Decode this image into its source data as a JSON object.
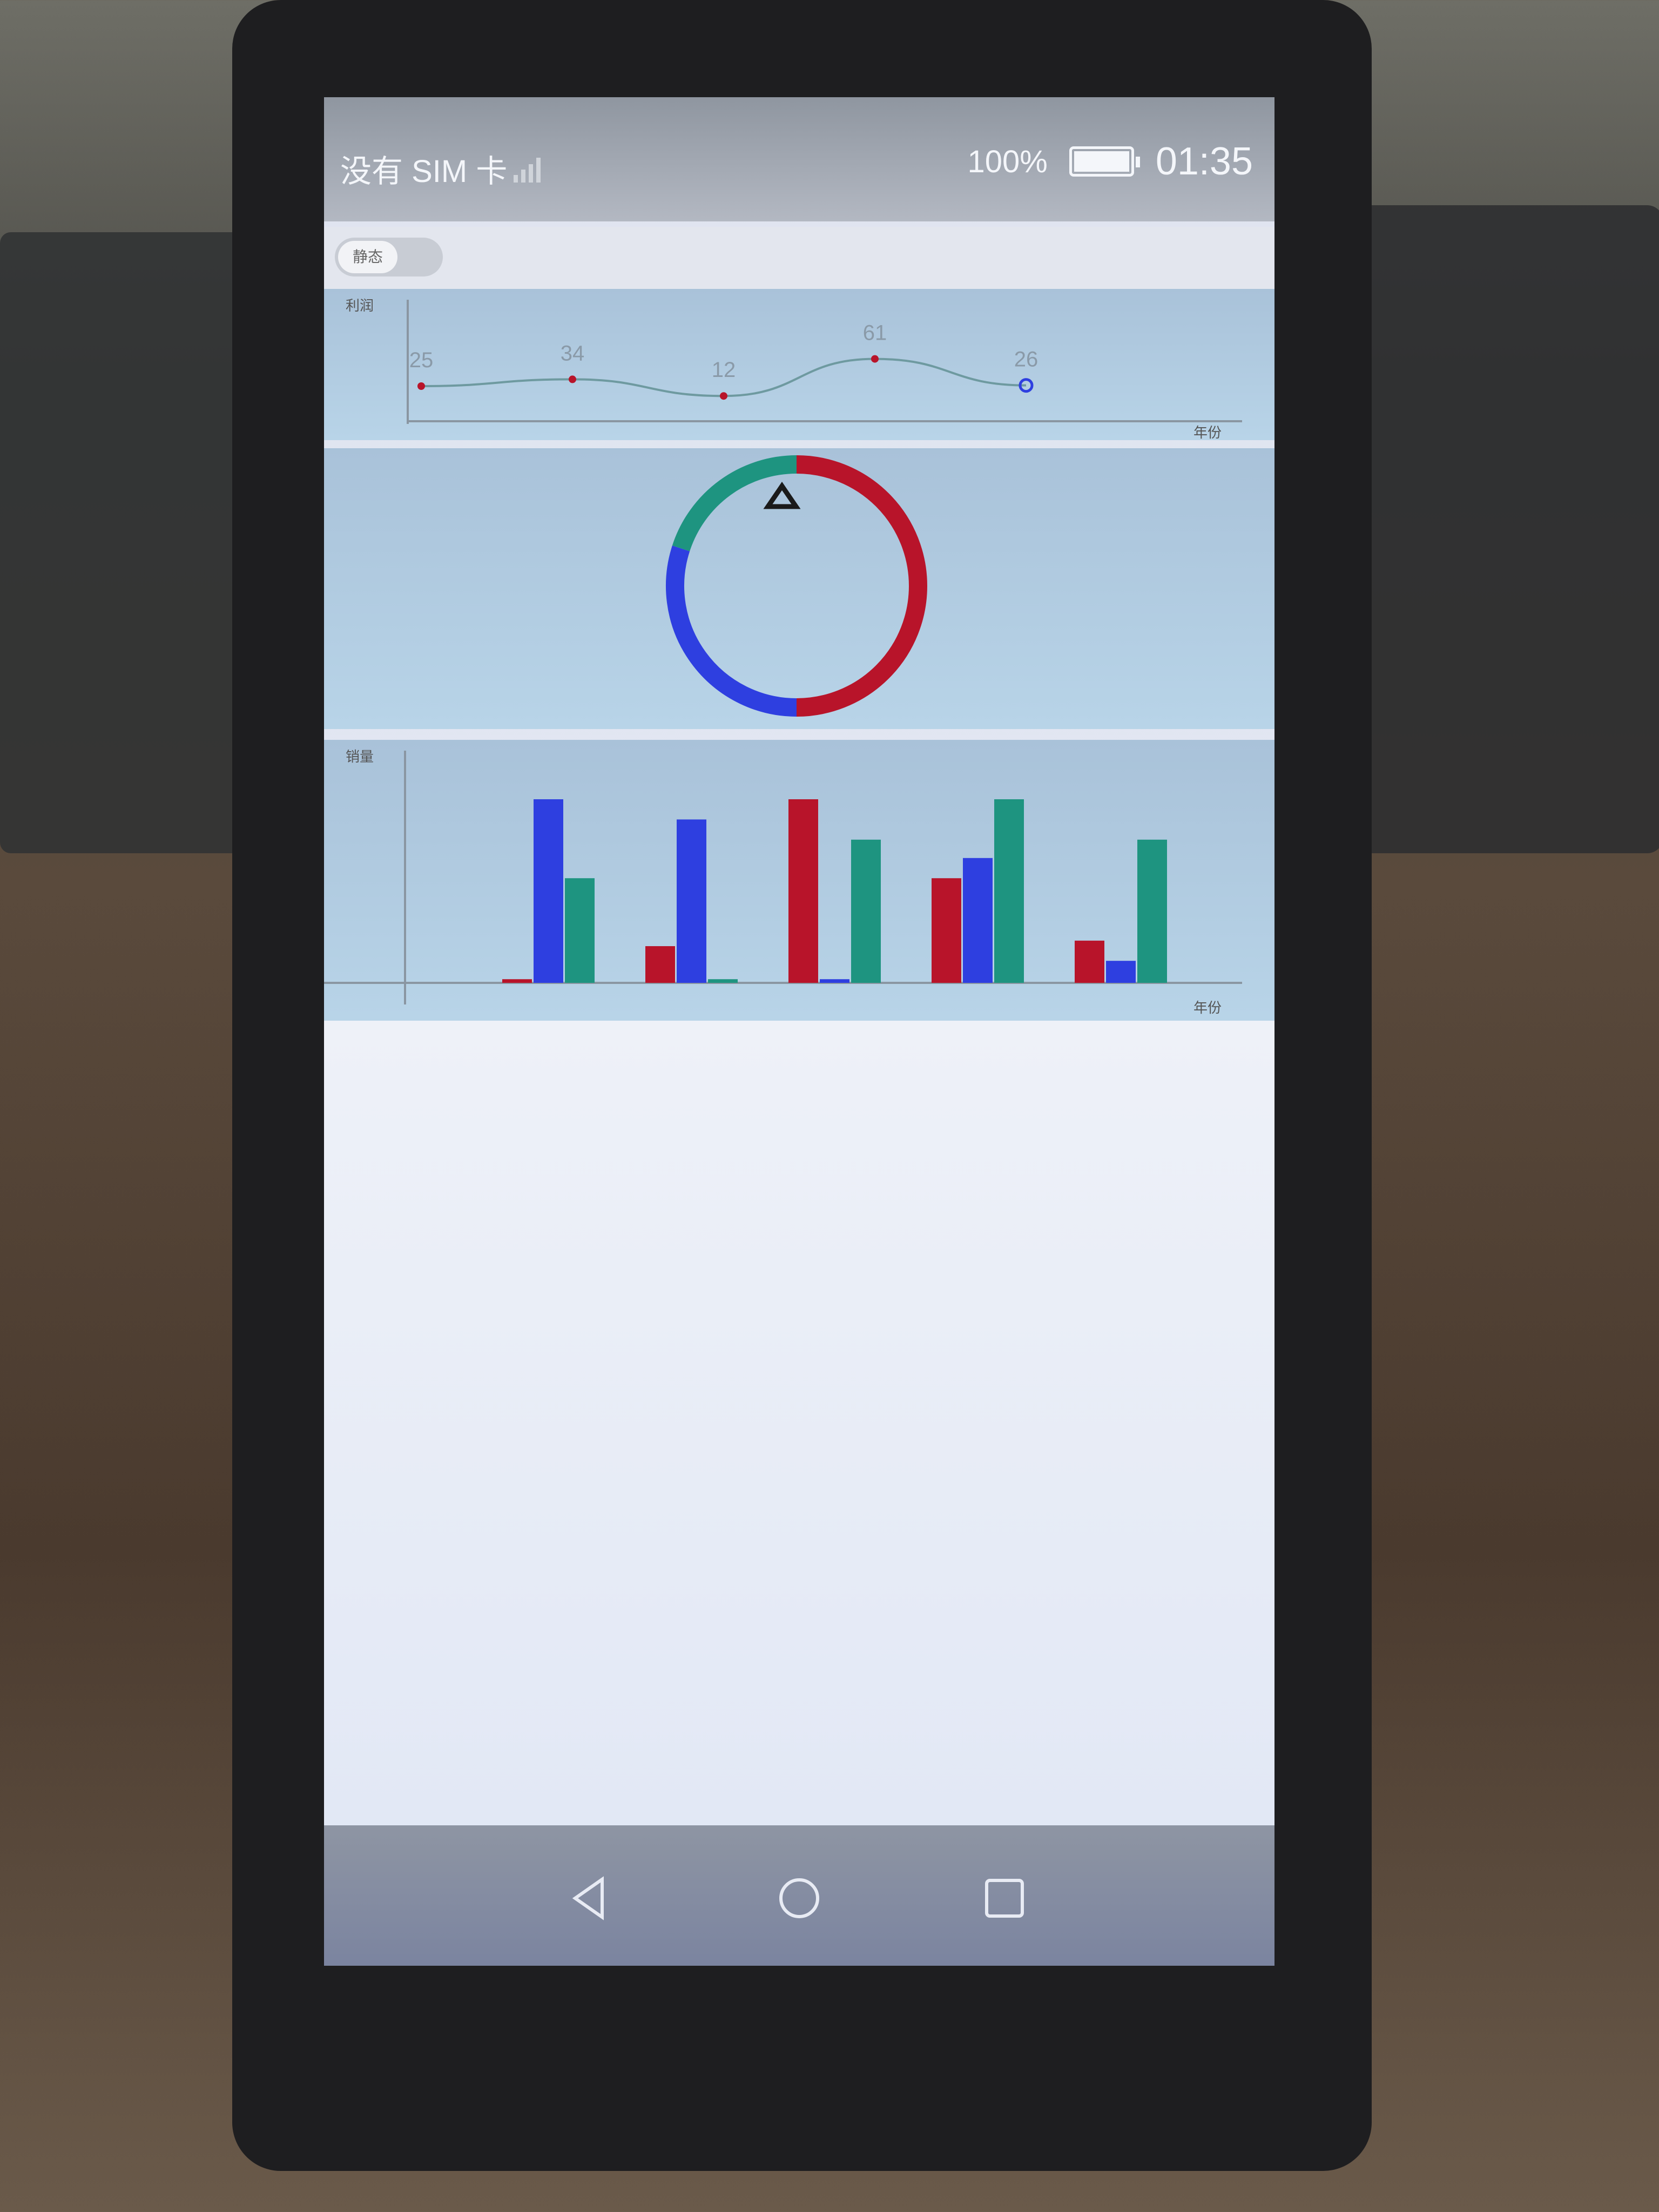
{
  "status_bar": {
    "carrier": "没有 SIM 卡",
    "battery_percent": "100%",
    "time": "01:35"
  },
  "toggle": {
    "label": "静态"
  },
  "line_chart": {
    "ylabel": "利润",
    "xlabel": "年份"
  },
  "bar_chart": {
    "ylabel": "销量",
    "xlabel": "年份"
  },
  "colors": {
    "red": "#b8142a",
    "blue": "#2e3fe0",
    "teal": "#1e9480",
    "line": "#6e9aa0"
  },
  "chart_data": [
    {
      "type": "line",
      "values": [
        25,
        34,
        12,
        61,
        26
      ],
      "ylabel": "利润",
      "xlabel": "年份"
    },
    {
      "type": "pie",
      "slices": [
        {
          "color": "#b8142a",
          "value": 50
        },
        {
          "color": "#2e3fe0",
          "value": 30
        },
        {
          "color": "#1e9480",
          "value": 20
        }
      ]
    },
    {
      "type": "bar",
      "ylabel": "销量",
      "xlabel": "年份",
      "series": [
        {
          "color": "#b8142a",
          "values": [
            2,
            20,
            100,
            57,
            23
          ]
        },
        {
          "color": "#2e3fe0",
          "values": [
            100,
            89,
            2,
            68,
            12
          ]
        },
        {
          "color": "#1e9480",
          "values": [
            57,
            2,
            78,
            100,
            78
          ]
        }
      ],
      "ylim": [
        0,
        100
      ]
    }
  ]
}
